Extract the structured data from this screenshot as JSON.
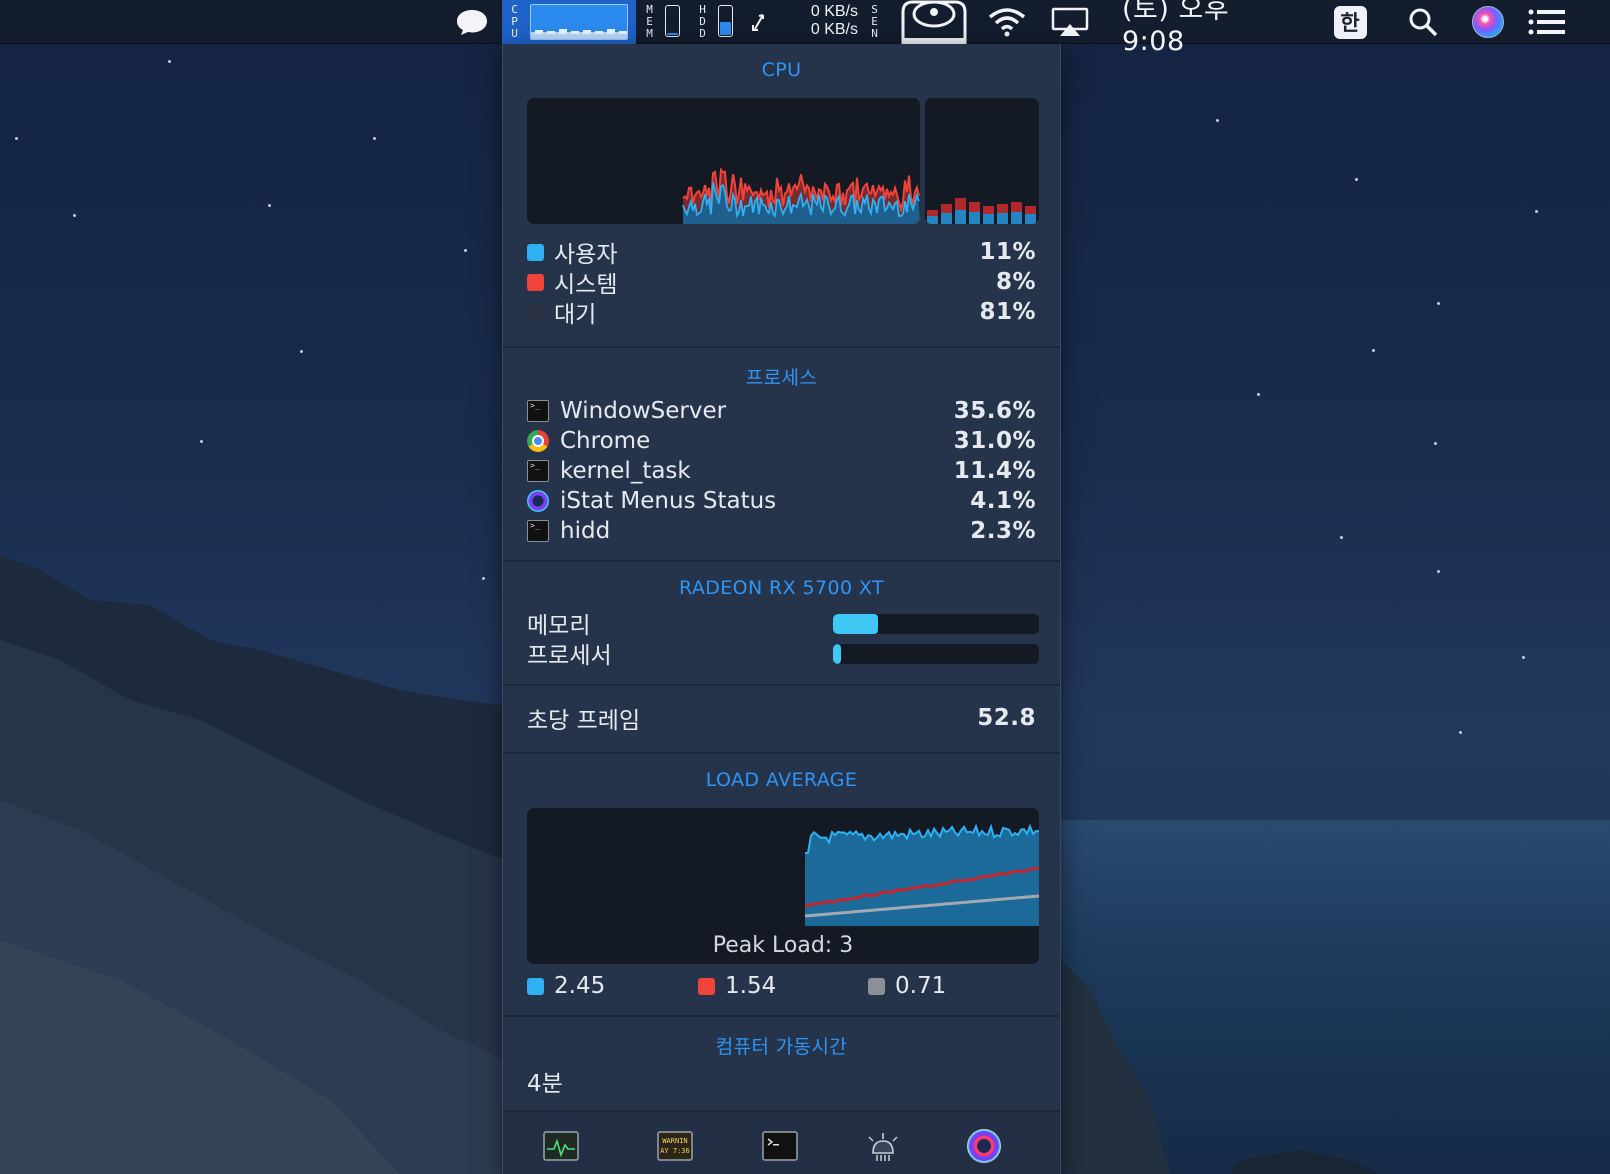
{
  "menubar": {
    "cpu_label": "CPU",
    "mem_label": "MEM",
    "hdd_label": "HDD",
    "sen_label": "SEN",
    "net_up": "0 KB/s",
    "net_down": "0 KB/s",
    "clock": "(토) 오후 9:08",
    "input_method": "한",
    "icons": [
      "message-icon",
      "network-arrows-icon",
      "drive-icon",
      "wifi-icon",
      "airplay-icon",
      "search-icon",
      "siri-icon",
      "notification-center-icon"
    ]
  },
  "cpu": {
    "title": "CPU",
    "user_label": "사용자",
    "user_value": "11%",
    "system_label": "시스템",
    "system_value": "8%",
    "idle_label": "대기",
    "idle_value": "81%",
    "colors": {
      "user": "#2fb0f0",
      "system": "#f0443a",
      "idle": "#2b3340"
    }
  },
  "processes": {
    "title": "프로세스",
    "items": [
      {
        "name": "WindowServer",
        "value": "35.6%",
        "icon": "terminal-icon"
      },
      {
        "name": "Chrome",
        "value": "31.0%",
        "icon": "chrome-icon"
      },
      {
        "name": "kernel_task",
        "value": "11.4%",
        "icon": "terminal-icon"
      },
      {
        "name": "iStat Menus Status",
        "value": "4.1%",
        "icon": "istat-icon"
      },
      {
        "name": "hidd",
        "value": "2.3%",
        "icon": "terminal-icon"
      }
    ]
  },
  "gpu": {
    "title": "RADEON RX 5700 XT",
    "memory_label": "메모리",
    "memory_fraction": 0.22,
    "processor_label": "프로세서",
    "processor_fraction": 0.04
  },
  "fps": {
    "label": "초당 프레임",
    "value": "52.8"
  },
  "load": {
    "title": "LOAD AVERAGE",
    "peak_label": "Peak Load: 3",
    "avg1": "2.45",
    "avg5": "1.54",
    "avg15": "0.71",
    "colors": {
      "avg1": "#2fb0f0",
      "avg5": "#f0443a",
      "avg15": "#8a8f98"
    }
  },
  "uptime": {
    "title": "컴퓨터 가동시간",
    "value": "4분"
  },
  "toolbar": {
    "buttons": [
      "activity-monitor-icon",
      "console-icon",
      "terminal-icon",
      "sensor-icon",
      "istat-menus-icon"
    ],
    "console_text_1": "WARNIN",
    "console_text_2": "AY 7:36"
  }
}
